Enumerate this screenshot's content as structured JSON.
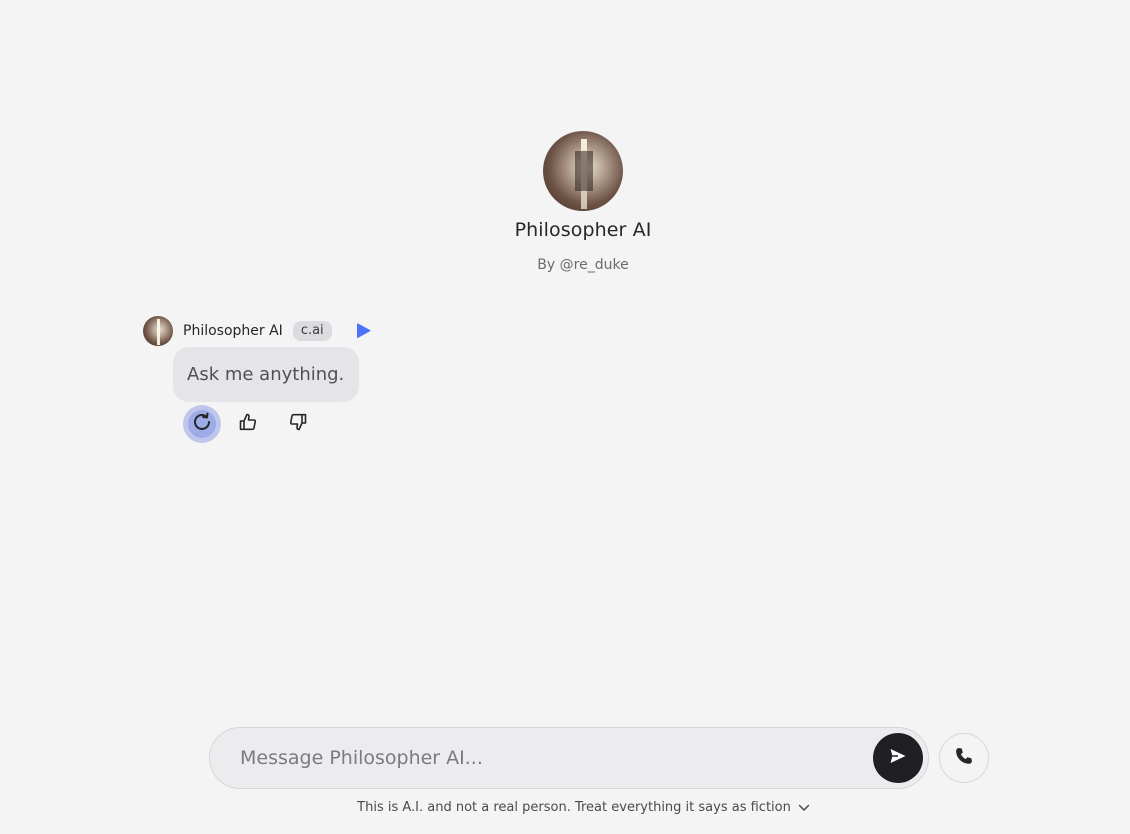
{
  "character": {
    "name": "Philosopher AI",
    "author": "By @re_duke"
  },
  "message": {
    "sender": "Philosopher AI",
    "tag": "c.ai",
    "text": "Ask me anything."
  },
  "composer": {
    "placeholder": "Message Philosopher AI..."
  },
  "disclaimer": "This is A.I. and not a real person. Treat everything it says as fiction",
  "colors": {
    "background": "#f4f4f4",
    "bubble": "#e5e4e9",
    "accent": "#4c72f5",
    "send_button": "#202024",
    "regenerate_active": "#bec6ec"
  },
  "icons": {
    "play": "play-icon",
    "regenerate": "regenerate-icon",
    "thumbs_up": "thumbs-up-icon",
    "thumbs_down": "thumbs-down-icon",
    "send": "send-icon",
    "phone": "phone-icon",
    "chevron": "chevron-down-icon"
  }
}
